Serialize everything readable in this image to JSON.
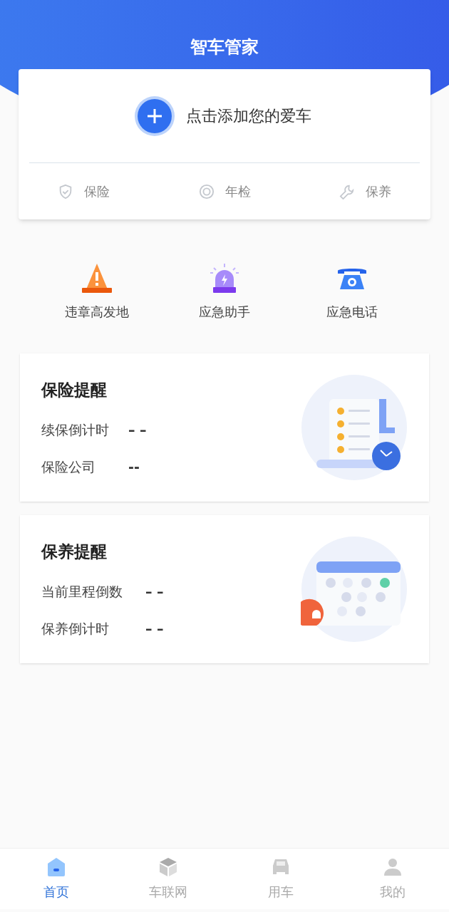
{
  "header": {
    "title": "智车管家"
  },
  "add_car": {
    "label": "点击添加您的爱车"
  },
  "car_services": [
    {
      "kind": "insurance",
      "label": "保险"
    },
    {
      "kind": "inspection",
      "label": "年检"
    },
    {
      "kind": "maintenance",
      "label": "保养"
    }
  ],
  "shortcuts": [
    {
      "kind": "violation",
      "label": "违章高发地"
    },
    {
      "kind": "assistant",
      "label": "应急助手"
    },
    {
      "kind": "phone",
      "label": "应急电话"
    }
  ],
  "reminders": [
    {
      "kind": "insurance",
      "title": "保险提醒",
      "rows": [
        {
          "label": "续保倒计时",
          "value": "– –"
        },
        {
          "label": "保险公司",
          "value": "--"
        }
      ]
    },
    {
      "kind": "maintenance",
      "title": "保养提醒",
      "rows": [
        {
          "label": "当前里程倒数",
          "value": "– –"
        },
        {
          "label": "保养倒计时",
          "value": "– –"
        }
      ]
    }
  ],
  "tab_bar": [
    {
      "kind": "home",
      "label": "首页",
      "selected": true
    },
    {
      "kind": "network",
      "label": "车联网",
      "selected": false
    },
    {
      "kind": "car",
      "label": "用车",
      "selected": false
    },
    {
      "kind": "profile",
      "label": "我的",
      "selected": false
    }
  ]
}
